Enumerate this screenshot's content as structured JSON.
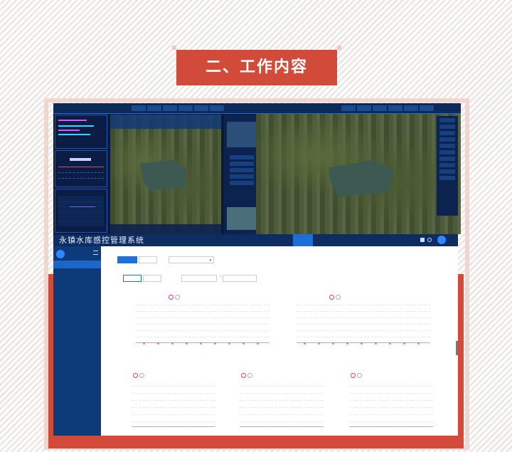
{
  "title": "二、工作内容",
  "left_dashboard": {
    "header": "",
    "left_panels": [
      {
        "title": ""
      },
      {
        "title": ""
      },
      {
        "title": ""
      }
    ]
  },
  "right_dashboard": {
    "header": ""
  },
  "app": {
    "title": "永镇水库感控管理系统",
    "user": {
      "name": "",
      "role": ""
    },
    "nav": [
      {
        "label": ""
      },
      {
        "label": ""
      },
      {
        "label": ""
      },
      {
        "label": ""
      },
      {
        "label": ""
      },
      {
        "label": ""
      },
      {
        "label": ""
      },
      {
        "label": ""
      },
      {
        "label": ""
      },
      {
        "label": ""
      }
    ],
    "sidebar": [
      {
        "label": ""
      },
      {
        "label": ""
      },
      {
        "label": ""
      },
      {
        "label": ""
      }
    ],
    "tabs": [
      {
        "label": ""
      },
      {
        "label": ""
      }
    ],
    "select_value": "",
    "buttons": [
      {
        "label": ""
      },
      {
        "label": ""
      }
    ],
    "date_from": "",
    "date_to": ""
  },
  "colors": {
    "banner": "#d24a3a",
    "frame": "#d24a3a",
    "nav": "#0c2c62",
    "active": "#1d6fd8"
  }
}
